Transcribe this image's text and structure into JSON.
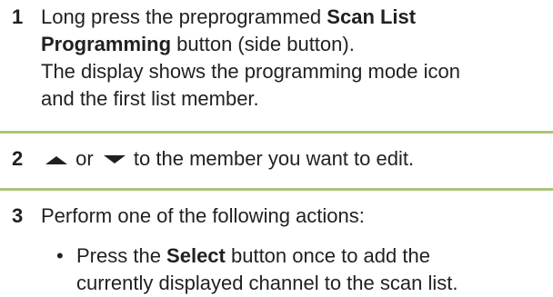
{
  "steps": [
    {
      "number": "1",
      "line1_pre": "Long press the preprogrammed ",
      "line1_bold": "Scan List",
      "line2_bold": "Programming",
      "line2_post": " button (side button).",
      "line3": "The display shows the programming mode icon",
      "line4": "and the first list member."
    },
    {
      "number": "2",
      "up_icon": "up-arrow-icon",
      "mid_text": " or ",
      "down_icon": "down-arrow-icon",
      "post_text": " to the member you want to edit."
    },
    {
      "number": "3",
      "text": "Perform one of the following actions:",
      "bullet": {
        "dot": "•",
        "pre": "Press the ",
        "bold": "Select",
        "post": " button once to add the",
        "line2": "currently displayed channel to the scan list."
      }
    }
  ],
  "colors": {
    "divider": "#a9c47c",
    "text": "#231f20"
  }
}
